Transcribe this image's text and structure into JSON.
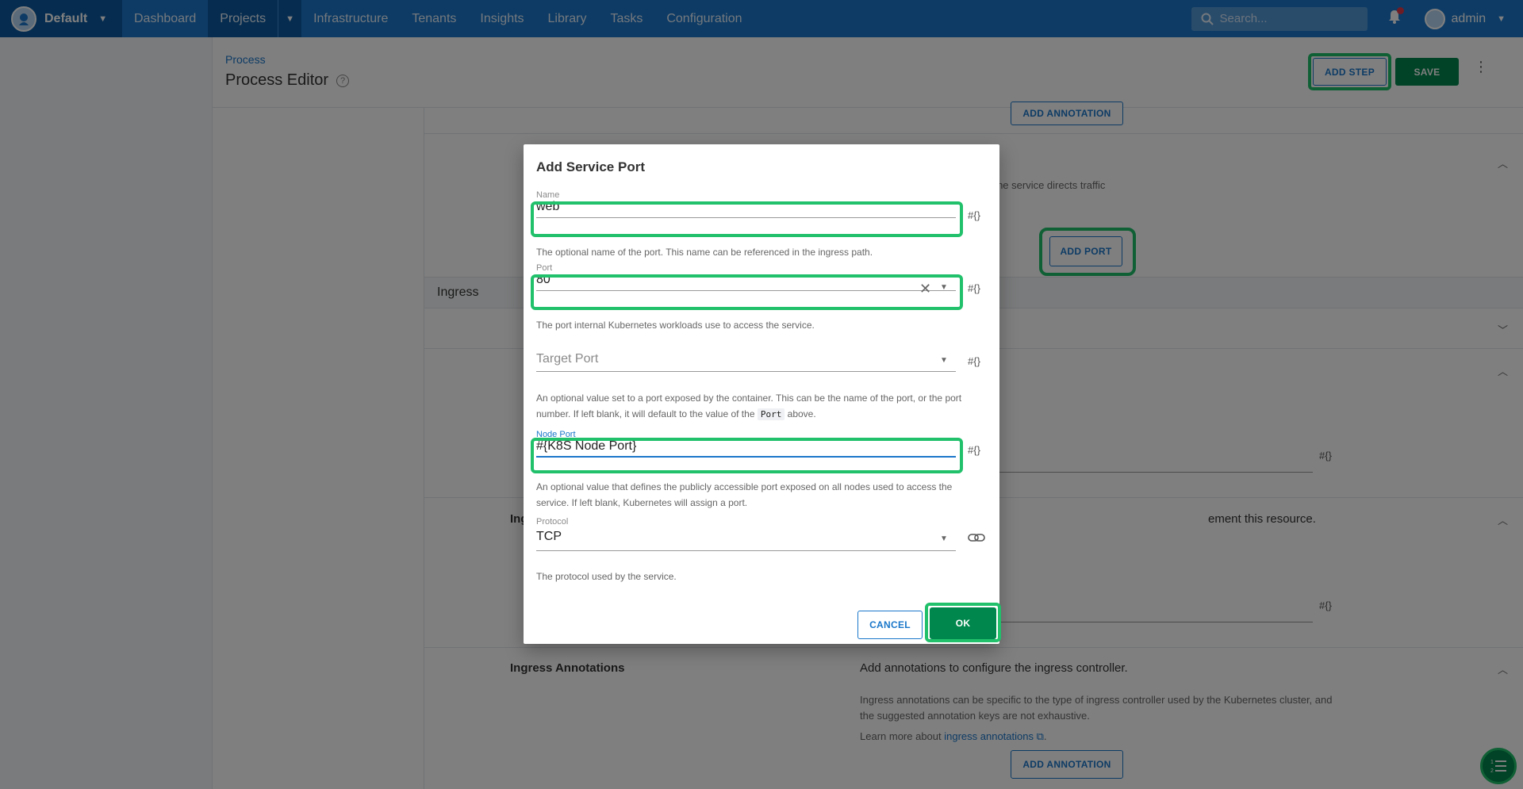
{
  "topnav": {
    "space": "Default",
    "items": [
      "Dashboard",
      "Projects",
      "Infrastructure",
      "Tenants",
      "Insights",
      "Library",
      "Tasks",
      "Configuration"
    ],
    "search_placeholder": "Search...",
    "user": "admin"
  },
  "page": {
    "breadcrumb": "Process",
    "title": "Process Editor",
    "add_step": "ADD STEP",
    "save": "SAVE"
  },
  "background": {
    "add_annotation_top": "ADD ANNOTATION",
    "service_traffic_text": "at the service directs traffic",
    "add_port": "ADD PORT",
    "ingress_title": "Ingress",
    "ingress_label_partial": "Ing",
    "ingress_desc_partial": "ement this resource.",
    "ingress_annotations_label": "Ingress Annotations",
    "ingress_annotations_desc": "Add annotations to configure the ingress controller.",
    "ingress_annotations_help": "Ingress annotations can be specific to the type of ingress controller used by the Kubernetes cluster, and the suggested annotation keys are not exhaustive.",
    "learn_more_prefix": "Learn more about ",
    "learn_more_link": "ingress annotations",
    "learn_more_suffix": ".",
    "add_annotation_bottom": "ADD ANNOTATION",
    "var_symbol": "#{}"
  },
  "dialog": {
    "title": "Add Service Port",
    "name": {
      "label": "Name",
      "value": "web",
      "help": "The optional name of the port. This name can be referenced in the ingress path."
    },
    "port": {
      "label": "Port",
      "value": "80",
      "help": "The port internal Kubernetes workloads use to access the service."
    },
    "target_port": {
      "placeholder": "Target Port",
      "help_1": "An optional value set to a port exposed by the container. This can be the name of the port, or the port number. If left blank, it will default to the value of the ",
      "help_code": "Port",
      "help_2": " above."
    },
    "node_port": {
      "label": "Node Port",
      "value": "#{K8S Node Port}",
      "help": "An optional value that defines the publicly accessible port exposed on all nodes used to access the service. If left blank, Kubernetes will assign a port."
    },
    "protocol": {
      "label": "Protocol",
      "value": "TCP",
      "help": "The protocol used by the service."
    },
    "var_symbol": "#{}",
    "cancel": "CANCEL",
    "ok": "OK"
  }
}
